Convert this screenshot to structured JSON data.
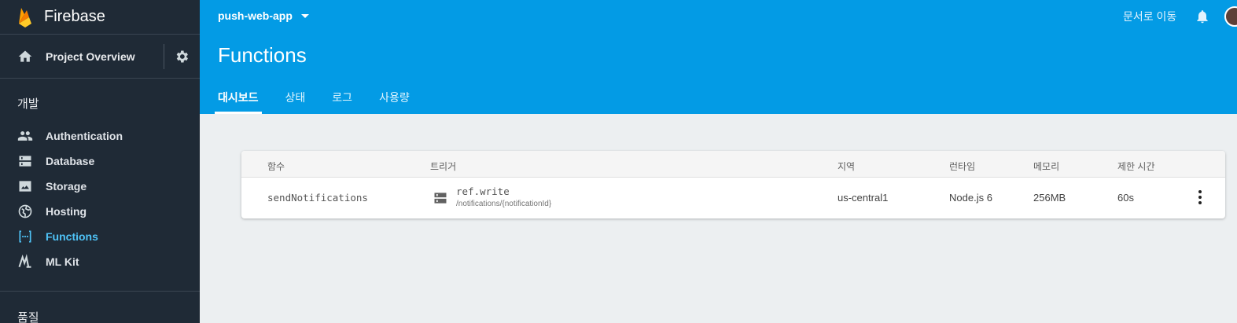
{
  "sidebar": {
    "brand": "Firebase",
    "overview_label": "Project Overview",
    "section_dev": "개발",
    "items": [
      {
        "label": "Authentication"
      },
      {
        "label": "Database"
      },
      {
        "label": "Storage"
      },
      {
        "label": "Hosting"
      },
      {
        "label": "Functions",
        "active": true
      },
      {
        "label": "ML Kit"
      }
    ],
    "section_quality": "품질"
  },
  "header": {
    "project": "push-web-app",
    "title": "Functions",
    "docs_link": "문서로 이동",
    "tabs": [
      {
        "label": "대시보드",
        "active": true
      },
      {
        "label": "상태"
      },
      {
        "label": "로그"
      },
      {
        "label": "사용량"
      }
    ]
  },
  "table": {
    "columns": [
      "함수",
      "트리거",
      "지역",
      "런타임",
      "메모리",
      "제한 시간"
    ],
    "rows": [
      {
        "function": "sendNotifications",
        "trigger": "ref.write",
        "trigger_path": "/notifications/{notificationId}",
        "region": "us-central1",
        "runtime": "Node.js 6",
        "memory": "256MB",
        "timeout": "60s"
      }
    ]
  },
  "colors": {
    "header_bg": "#039be5",
    "sidebar_bg": "#1f2a36",
    "active_nav": "#4fc3f7",
    "page_bg": "#eceff1"
  },
  "icons": [
    "firebase-logo",
    "home-icon",
    "gear-icon",
    "people-icon",
    "database-icon",
    "storage-icon",
    "globe-icon",
    "functions-icon",
    "mlkit-icon",
    "bell-icon",
    "server-icon",
    "more-vert-icon"
  ]
}
